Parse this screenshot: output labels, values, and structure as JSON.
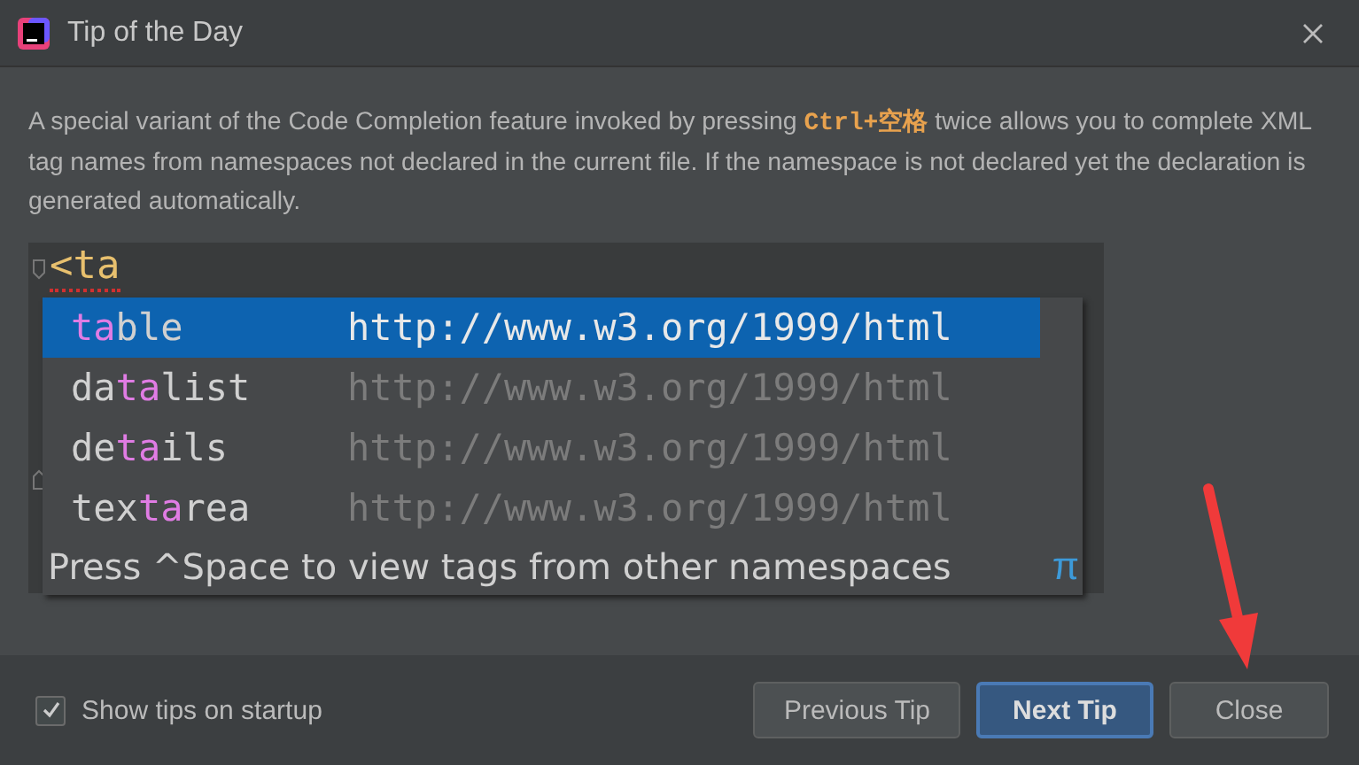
{
  "window": {
    "title": "Tip of the Day"
  },
  "tip": {
    "text": "A special variant of the Code Completion feature invoked by pressing **Ctrl+空格** twice allows you to complete XML tag names from namespaces not declared in the current file. If the namespace is not declared yet the declaration is generated automatically.",
    "editor": {
      "code_line": "<ta",
      "completion": {
        "items": [
          {
            "selected": true,
            "parts": [
              {
                "text": "ta",
                "match": true
              },
              {
                "text": "ble",
                "match": false
              }
            ],
            "namespace": "http://www.w3.org/1999/html"
          },
          {
            "selected": false,
            "parts": [
              {
                "text": "da",
                "match": false
              },
              {
                "text": "ta",
                "match": true
              },
              {
                "text": "list",
                "match": false
              }
            ],
            "namespace": "http://www.w3.org/1999/html"
          },
          {
            "selected": false,
            "parts": [
              {
                "text": "de",
                "match": false
              },
              {
                "text": "ta",
                "match": true
              },
              {
                "text": "ils",
                "match": false
              }
            ],
            "namespace": "http://www.w3.org/1999/html"
          },
          {
            "selected": false,
            "parts": [
              {
                "text": "tex",
                "match": false
              },
              {
                "text": "ta",
                "match": true
              },
              {
                "text": "rea",
                "match": false
              }
            ],
            "namespace": "http://www.w3.org/1999/html"
          }
        ],
        "hint": "Press ^Space to view tags from other namespaces",
        "hint_symbol": "π"
      }
    }
  },
  "footer": {
    "show_tips": {
      "label": "Show tips on startup",
      "checked": true
    },
    "buttons": [
      {
        "label": "Previous Tip",
        "kind": "normal"
      },
      {
        "label": "Next Tip",
        "kind": "default"
      },
      {
        "label": "Close",
        "kind": "normal"
      }
    ]
  }
}
